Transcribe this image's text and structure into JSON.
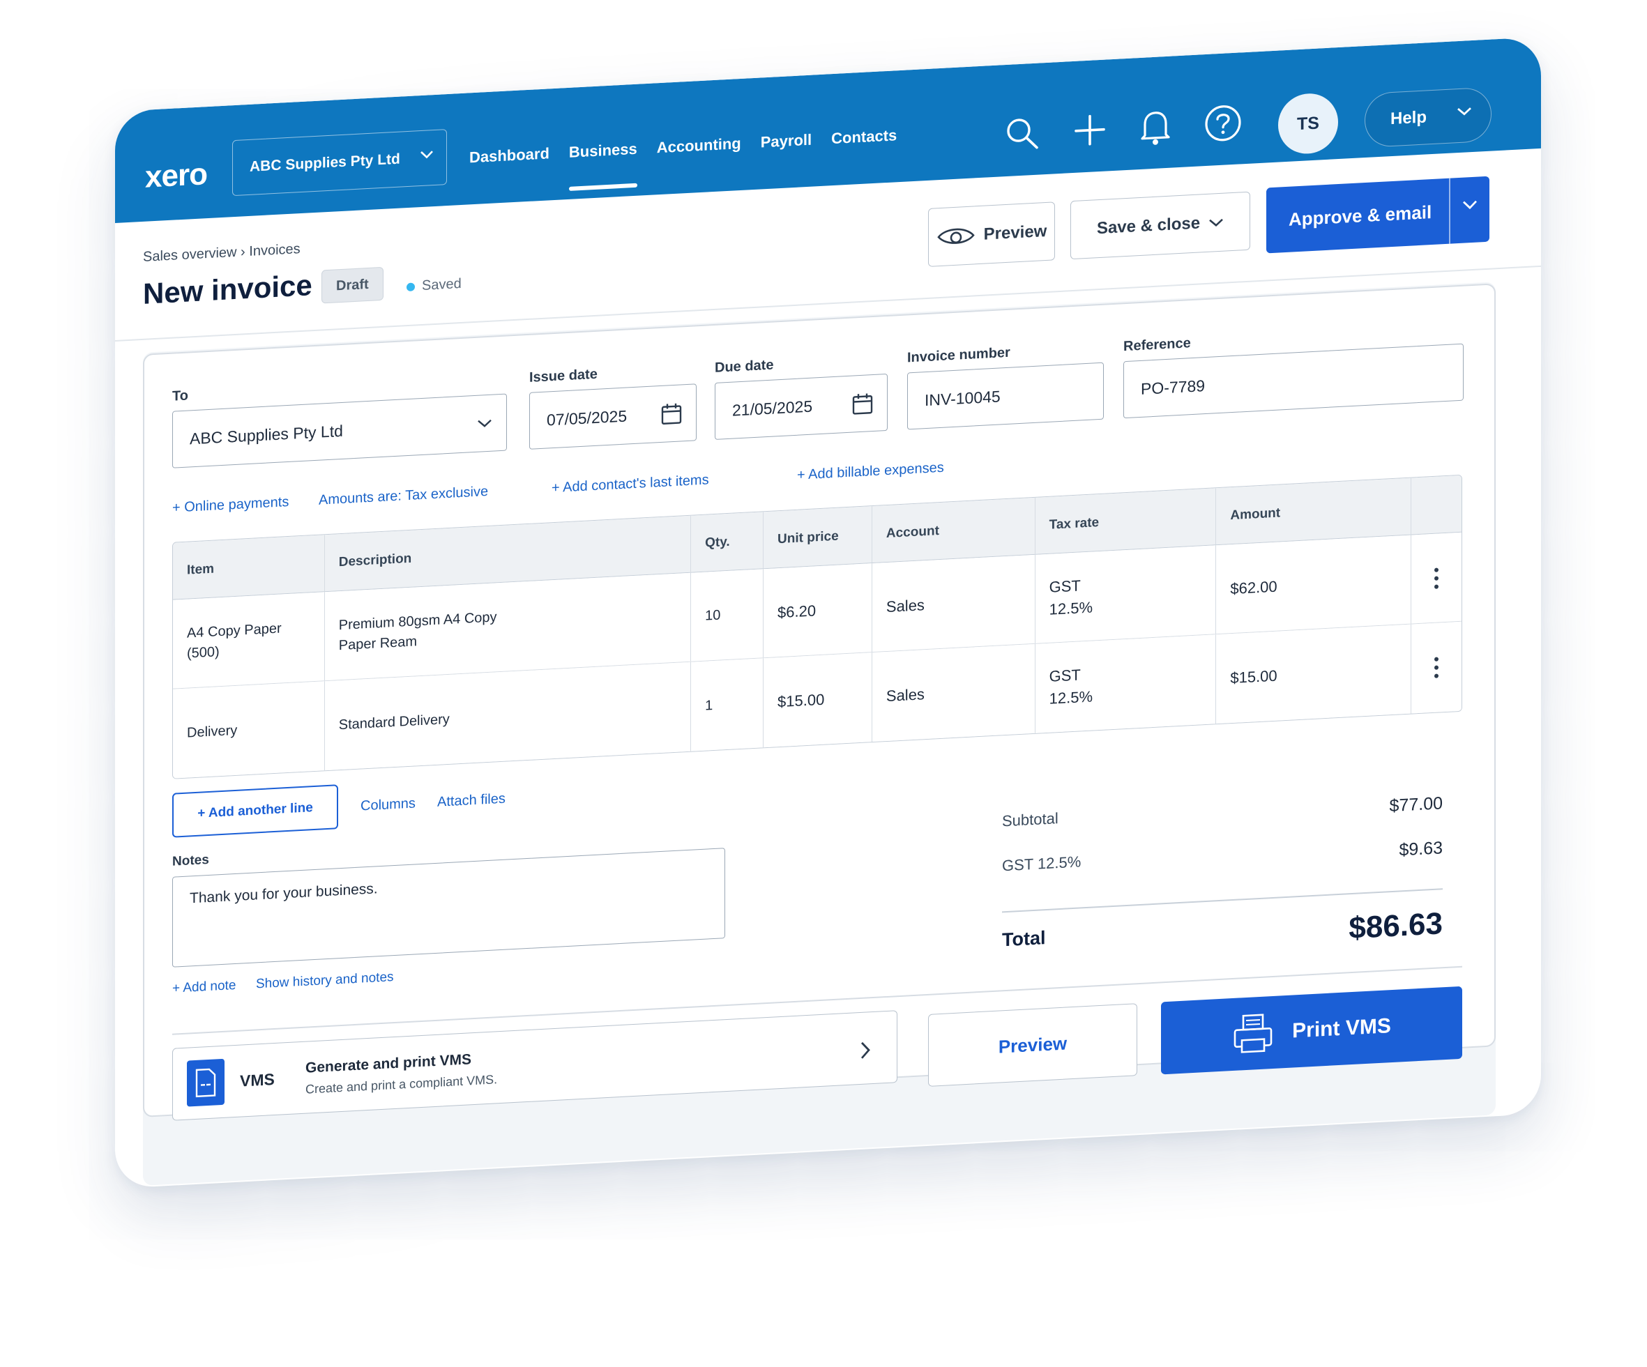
{
  "app": {
    "logo": "xero",
    "org_name": "ABC Supplies Pty Ltd",
    "nav": [
      "Dashboard",
      "Business",
      "Accounting",
      "Payroll",
      "Contacts"
    ],
    "active_nav": "Business",
    "icons": [
      "search-icon",
      "plus-icon",
      "bell-icon",
      "help-circle-icon"
    ],
    "avatar_initials": "TS",
    "help_label": "Help",
    "brand_color": "#0e77bf",
    "accent_color": "#1b5fd6"
  },
  "header": {
    "breadcrumb": "Sales overview › Invoices",
    "title": "New invoice",
    "badge": "Draft",
    "status": "Saved",
    "preview_label": "Preview",
    "save_close_label": "Save & close",
    "approve_label": "Approve & email"
  },
  "form": {
    "to_label": "To",
    "to_value": "ABC Supplies Pty Ltd",
    "issue_date_label": "Issue date",
    "issue_date": "07/05/2025",
    "due_date_label": "Due date",
    "due_date": "21/05/2025",
    "invoice_number_label": "Invoice number",
    "invoice_number": "INV-10045",
    "reference_label": "Reference",
    "reference": "PO-7789",
    "links": {
      "online_payments": "+ Online payments",
      "amounts": "Amounts are: Tax exclusive",
      "contact_items": "+ Add contact's last items",
      "billable": "+ Add billable expenses"
    }
  },
  "table": {
    "headers": [
      "Item",
      "Description",
      "Qty.",
      "Unit price",
      "Account",
      "Tax rate",
      "Amount"
    ],
    "rows": [
      {
        "item": "A4 Copy Paper (500)",
        "description_1": "Premium 80gsm A4 Copy",
        "description_2": "Paper Ream",
        "qty": "10",
        "unit_price": "$6.20",
        "account": "Sales",
        "tax_1": "GST",
        "tax_2": "12.5%",
        "amount": "$62.00"
      },
      {
        "item": "Delivery",
        "description_1": "Standard Delivery",
        "description_2": "",
        "qty": "1",
        "unit_price": "$15.00",
        "account": "Sales",
        "tax_1": "GST",
        "tax_2": "12.5%",
        "amount": "$15.00"
      }
    ],
    "add_line": "+ Add another line",
    "columns": "Columns",
    "attach": "Attach files"
  },
  "notes": {
    "label": "Notes",
    "value": "Thank you for your business.",
    "add_note": "+ Add note",
    "history": "Show history and notes"
  },
  "totals": {
    "subtotal_label": "Subtotal",
    "subtotal": "$77.00",
    "gst_label": "GST 12.5%",
    "gst": "$9.63",
    "total_label": "Total",
    "total": "$86.63"
  },
  "vms": {
    "name": "VMS",
    "title": "Generate and print VMS",
    "subtitle": "Create and print a compliant VMS.",
    "preview_label": "Preview",
    "print_label": "Print VMS"
  }
}
